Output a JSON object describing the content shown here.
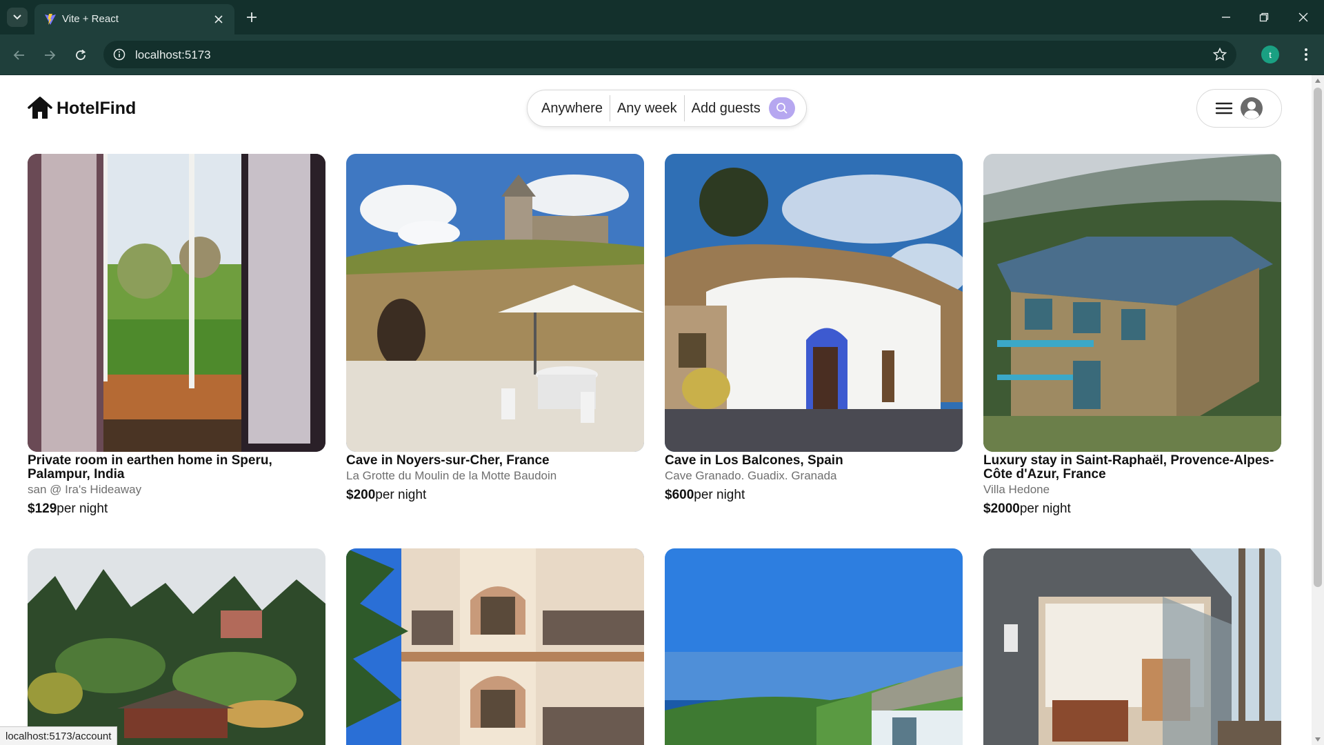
{
  "browser": {
    "tab_title": "Vite + React",
    "url": "localhost:5173",
    "profile_initial": "t",
    "status_url": "localhost:5173/account"
  },
  "header": {
    "brand": "HotelFind",
    "search": {
      "where": "Anywhere",
      "when": "Any week",
      "who": "Add guests"
    },
    "accent_color": "#b6a7f0"
  },
  "listings": [
    {
      "title": "Private room in earthen home in Speru, Palampur, India",
      "host": "san @ Ira's Hideaway",
      "price": "$129",
      "per": "per night"
    },
    {
      "title": "Cave in Noyers-sur-Cher, France",
      "host": "La Grotte du Moulin de la Motte Baudoin",
      "price": "$200",
      "per": "per night"
    },
    {
      "title": "Cave in Los Balcones, Spain",
      "host": "Cave Granado. Guadix. Granada",
      "price": "$600",
      "per": "per night"
    },
    {
      "title": "Luxury stay in Saint-Raphaël, Provence-Alpes-Côte d'Azur, France",
      "host": "Villa Hedone",
      "price": "$2000",
      "per": "per night"
    }
  ]
}
